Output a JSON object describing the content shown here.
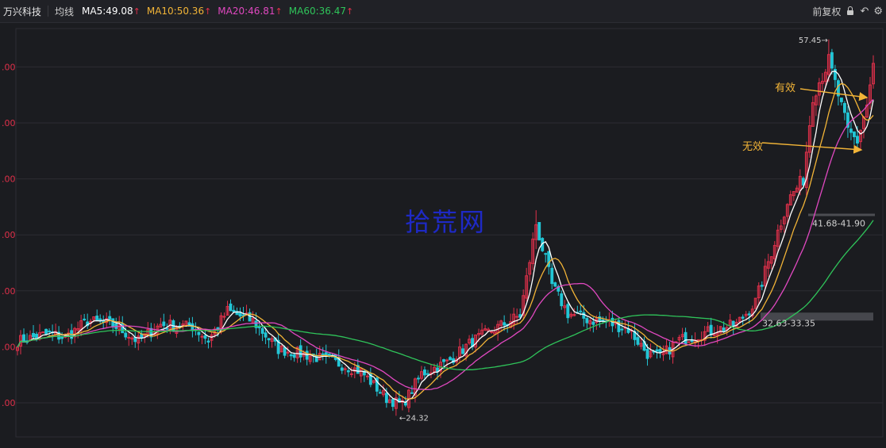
{
  "toolbar": {
    "stock_name": "万兴科技",
    "mode_label": "均线",
    "ma": [
      {
        "label": "MA5:49.08",
        "color": "#ffffff"
      },
      {
        "label": "MA10:50.36",
        "color": "#f2b437"
      },
      {
        "label": "MA20:46.81",
        "color": "#e048c0"
      },
      {
        "label": "MA60:36.47",
        "color": "#2fc45a"
      }
    ],
    "ma_arrow": "↑",
    "adjust_label": "前复权",
    "icons": [
      "lock-icon",
      "undo-icon",
      "settings-icon"
    ]
  },
  "colors": {
    "up": "#e0304a",
    "down": "#22c6d6",
    "ma5": "#ffffff",
    "ma10": "#f2b437",
    "ma20": "#e048c0",
    "ma60": "#2fc45a",
    "annotation": "#f2b437",
    "watermark": "#1f2bd8",
    "grid": "#2c2d33",
    "axis_label": "#e0304a"
  },
  "chart_data": {
    "type": "candlestick",
    "ylim": [
      20,
      58.5
    ],
    "y_ticks": [
      25,
      30,
      35,
      40,
      45,
      50,
      55
    ],
    "y_tick_labels": [
      ".00",
      ".00",
      ".00",
      ".00",
      ".00",
      ".00",
      ".00"
    ],
    "annotations": {
      "high_label": "57.45→",
      "low_label": "←24.32",
      "level1_label": "32.63-33.35",
      "level2_label": "41.68-41.90",
      "arrow_upper_label": "有效",
      "arrow_lower_label": "无效",
      "watermark": "拾荒网"
    },
    "zones": [
      {
        "label": "32.63-33.35",
        "low": 32.63,
        "high": 33.35
      },
      {
        "label": "41.68-41.90",
        "low": 41.68,
        "high": 41.9
      }
    ],
    "high": 57.45,
    "low": 24.32,
    "keypoints": [
      [
        0,
        30.5
      ],
      [
        10,
        31.2
      ],
      [
        15,
        30.8
      ],
      [
        22,
        32.3
      ],
      [
        30,
        32.0
      ],
      [
        38,
        30.5
      ],
      [
        45,
        32.0
      ],
      [
        55,
        31.8
      ],
      [
        60,
        30.6
      ],
      [
        66,
        33.2
      ],
      [
        74,
        32.3
      ],
      [
        82,
        29.8
      ],
      [
        92,
        29.2
      ],
      [
        100,
        28.6
      ],
      [
        108,
        27.8
      ],
      [
        116,
        25.4
      ],
      [
        121,
        24.8
      ],
      [
        127,
        27.6
      ],
      [
        135,
        28.6
      ],
      [
        143,
        30.5
      ],
      [
        150,
        31.6
      ],
      [
        158,
        32.8
      ],
      [
        163,
        41.0
      ],
      [
        168,
        35.5
      ],
      [
        173,
        33.0
      ],
      [
        180,
        32.4
      ],
      [
        185,
        32.2
      ],
      [
        192,
        31.6
      ],
      [
        198,
        29.4
      ],
      [
        202,
        29.1
      ],
      [
        208,
        30.6
      ],
      [
        218,
        31.4
      ],
      [
        226,
        32.0
      ],
      [
        232,
        34.0
      ],
      [
        237,
        38.5
      ],
      [
        242,
        43.0
      ],
      [
        247,
        45.0
      ],
      [
        250,
        52.5
      ],
      [
        255,
        55.5
      ],
      [
        258,
        52.5
      ],
      [
        261,
        49.2
      ],
      [
        264,
        48.4
      ],
      [
        267,
        51.6
      ],
      [
        269,
        55.0
      ]
    ],
    "ma_periods": [
      5,
      10,
      20,
      60
    ],
    "n": 270,
    "seed": 7
  }
}
